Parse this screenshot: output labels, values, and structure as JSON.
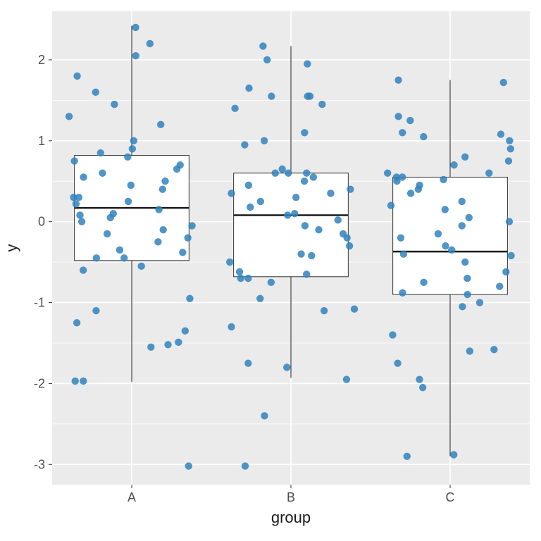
{
  "chart_data": {
    "type": "boxplot_jitter",
    "xlabel": "group",
    "ylabel": "y",
    "ylim": [
      -3.25,
      2.6
    ],
    "y_ticks": [
      -3,
      -2,
      -1,
      0,
      1,
      2
    ],
    "y_minor": [
      -2.5,
      -1.5,
      -0.5,
      0.5,
      1.5
    ],
    "categories": [
      "A",
      "B",
      "C"
    ],
    "boxes": [
      {
        "group": "A",
        "min": -1.98,
        "q1": -0.48,
        "median": 0.17,
        "q3": 0.82,
        "max": 2.42
      },
      {
        "group": "B",
        "min": -1.93,
        "q1": -0.68,
        "median": 0.08,
        "q3": 0.6,
        "max": 2.17
      },
      {
        "group": "C",
        "min": -2.9,
        "q1": -0.9,
        "median": -0.37,
        "q3": 0.55,
        "max": 1.75
      }
    ],
    "box_width": 0.72,
    "jitter_width": 0.4,
    "point_radius": 5.2,
    "point_color": "#3182bd",
    "points": {
      "A": [
        -1.97,
        -1.97,
        -1.55,
        -1.25,
        -1.52,
        -1.1,
        -1.49,
        -3.02,
        -1.35,
        -0.95,
        -0.55,
        -0.6,
        -0.45,
        -0.38,
        -0.35,
        -0.45,
        -0.25,
        -0.2,
        -0.1,
        -0.15,
        -0.05,
        0.0,
        0.05,
        0.1,
        0.08,
        0.15,
        0.22,
        0.3,
        0.25,
        0.4,
        0.3,
        0.5,
        0.6,
        0.45,
        0.55,
        0.7,
        0.65,
        0.8,
        0.75,
        0.85,
        0.9,
        1.0,
        1.2,
        1.3,
        1.45,
        1.6,
        1.8,
        2.05,
        2.2,
        2.4
      ],
      "B": [
        -3.02,
        -2.4,
        -1.8,
        -1.75,
        -1.95,
        -1.3,
        -1.1,
        -1.08,
        -0.95,
        -0.75,
        -0.7,
        -0.65,
        -0.7,
        -0.62,
        -0.5,
        -0.4,
        -0.42,
        -0.3,
        -0.2,
        -0.15,
        -0.1,
        -0.05,
        0.02,
        0.08,
        0.1,
        0.18,
        0.25,
        0.3,
        0.35,
        0.4,
        0.45,
        0.5,
        0.55,
        0.6,
        0.6,
        0.6,
        0.65,
        0.95,
        1.0,
        1.1,
        1.4,
        1.45,
        1.55,
        1.55,
        1.55,
        1.65,
        1.95,
        2.0,
        2.17,
        0.35
      ],
      "C": [
        -2.9,
        -2.88,
        -2.05,
        -1.95,
        -1.75,
        -1.58,
        -1.6,
        -1.4,
        -1.05,
        -1.0,
        -0.9,
        -0.88,
        -0.8,
        -0.75,
        -0.7,
        -0.62,
        -0.5,
        -0.42,
        -0.4,
        -0.35,
        -0.3,
        -0.2,
        -0.15,
        -0.05,
        0.0,
        0.05,
        0.15,
        0.2,
        0.25,
        0.35,
        0.4,
        0.52,
        0.5,
        0.45,
        0.55,
        0.55,
        0.6,
        0.6,
        0.7,
        0.75,
        0.8,
        0.9,
        1.0,
        1.05,
        1.08,
        1.1,
        1.25,
        1.3,
        1.72,
        1.75
      ]
    }
  }
}
